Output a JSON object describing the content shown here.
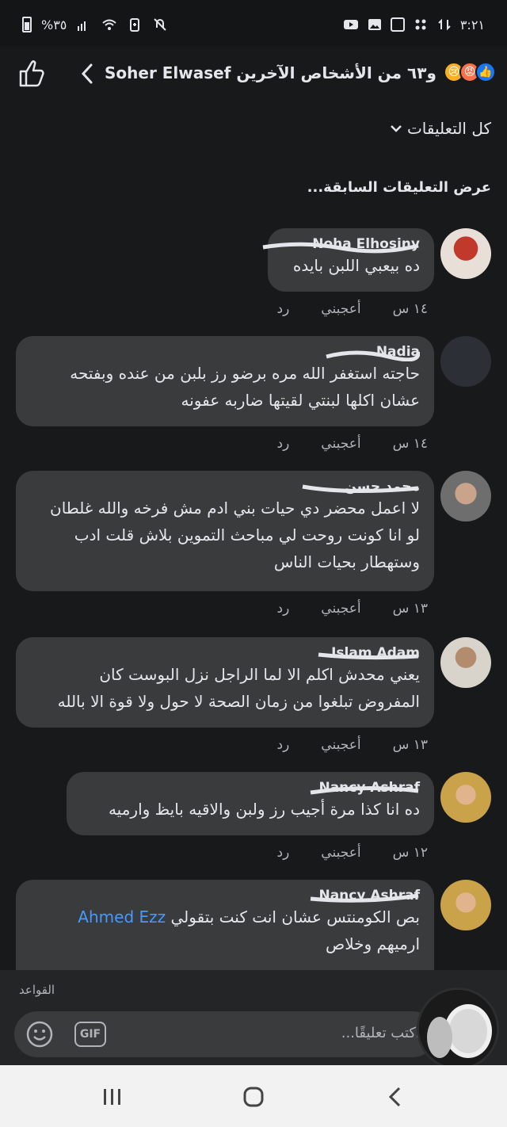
{
  "status_bar": {
    "time": "٣:٢١",
    "battery_text": "%٣٥"
  },
  "header": {
    "title": "و٦٣ من الأشخاص الآخرين Soher Elwasef"
  },
  "filter_label": "كل التعليقات",
  "view_older": "عرض التعليقات السابقة...",
  "comments": [
    {
      "name": "Noha Elhosiny",
      "text": "ده بيعبي اللبن بايده",
      "time": "١٤ س",
      "like": "أعجبني",
      "reply": "رد"
    },
    {
      "name": "Nadia",
      "text": "حاجته استغفر الله مره برضو رز بلبن من عنده وبفتحه\nعشان اكلها لبنتي لقيتها  ضاربه عفونه",
      "time": "١٤ س",
      "like": "أعجبني",
      "reply": "رد"
    },
    {
      "name": "محمد حسن",
      "text": "لا اعمل محضر دي حيات بني ادم مش فرخه والله غلطان\nلو انا كونت روحت لي مباحث التموين بلاش قلت ادب\nوستهطار بحيات الناس",
      "time": "١٣ س",
      "like": "أعجبني",
      "reply": "رد"
    },
    {
      "name": "Islam Adam",
      "text": "يعني محدش اكلم الا لما الراجل نزل البوست كان\nالمفروض تبلغوا من زمان الصحة لا حول ولا قوة الا بالله",
      "time": "١٣ س",
      "like": "أعجبني",
      "reply": "رد"
    },
    {
      "name": "Nancy Ashraf",
      "text": "ده انا كذا مرة أجيب رز ولبن والاقيه بايظ وارميه",
      "time": "١٢ س",
      "like": "أعجبني",
      "reply": "رد"
    },
    {
      "name": "Nancy Ashraf",
      "mention": "Ahmed Ezz",
      "text_line1": "بص الكومنتس عشان انت كنت بتقولي",
      "text_line2": "ارميهم وخلاص"
    }
  ],
  "composer": {
    "rules_link": "القواعد",
    "placeholder": "اكتب تعليقًا...",
    "gif_label": "GIF"
  },
  "colors": {
    "background": "#18191a",
    "bubble": "#3a3b3c",
    "text": "#e4e6eb",
    "muted": "#b0b3b8",
    "link": "#4599ff",
    "like_blue": "#1877f2",
    "angry_orange": "#f7714c"
  },
  "icons": [
    "thumbs-up-icon",
    "back-arrow-icon",
    "like-reaction-icon",
    "angry-reaction-icon",
    "sad-reaction-icon",
    "chevron-down-icon",
    "smile-icon",
    "gif-icon",
    "recents-icon",
    "home-icon",
    "nav-back-icon"
  ]
}
